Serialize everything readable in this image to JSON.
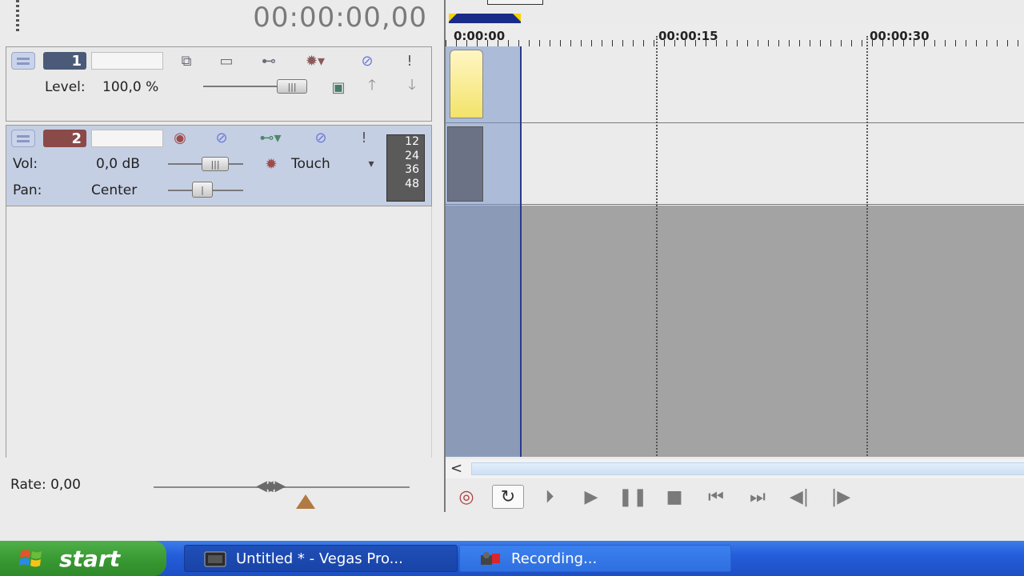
{
  "time_display": "00:00:00,00",
  "tracks": [
    {
      "number": "1",
      "number_color": "#4a5a78",
      "level_label": "Level:",
      "level_value": "100,0 %"
    },
    {
      "number": "2",
      "number_color": "#8a4a48",
      "vol_label": "Vol:",
      "vol_value": "0,0 dB",
      "pan_label": "Pan:",
      "pan_value": "Center",
      "automation_mode": "Touch",
      "meter_labels": [
        "12",
        "24",
        "36",
        "48"
      ]
    }
  ],
  "rate": {
    "label": "Rate: 0,00"
  },
  "ruler": {
    "labels": [
      "0:00:00",
      "00:00:15",
      "00:00:30"
    ]
  },
  "icons": {
    "record": "record-icon",
    "loop": "loop-icon",
    "play_from_start": "play-from-start-icon",
    "play": "play-icon",
    "pause": "pause-icon",
    "stop": "stop-icon",
    "go_to_start": "go-to-start-icon",
    "go_to_end": "go-to-end-icon",
    "prev_frame": "previous-frame-icon",
    "next_frame": "next-frame-icon"
  },
  "taskbar": {
    "start_label": "start",
    "items": [
      {
        "label": "Untitled * - Vegas Pro..."
      },
      {
        "label": "Recording..."
      }
    ]
  }
}
